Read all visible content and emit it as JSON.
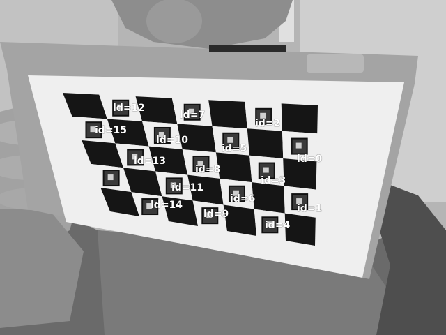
{
  "scene": {
    "description_tags": [
      "person",
      "laptop",
      "charuco-board",
      "aruco-markers"
    ],
    "colors": {
      "background": "#8a8a8a",
      "wall": "#b9b9b9",
      "shirt": "#5e5e5e",
      "board_frame": "#a8a8a8",
      "paper": "#f2f2f2",
      "square": "#151515",
      "label": "#ffffff"
    }
  },
  "markers": [
    {
      "id_label": "id=12"
    },
    {
      "id_label": "id=7"
    },
    {
      "id_label": "id=2"
    },
    {
      "id_label": "id=15"
    },
    {
      "id_label": "id=10"
    },
    {
      "id_label": "id=5"
    },
    {
      "id_label": "id=0"
    },
    {
      "id_label": "id=13"
    },
    {
      "id_label": "id=8"
    },
    {
      "id_label": "id=3"
    },
    {
      "id_label": "id=11"
    },
    {
      "id_label": "id=6"
    },
    {
      "id_label": "id=14"
    },
    {
      "id_label": "id=1"
    },
    {
      "id_label": "id=9"
    },
    {
      "id_label": "id=4"
    }
  ]
}
